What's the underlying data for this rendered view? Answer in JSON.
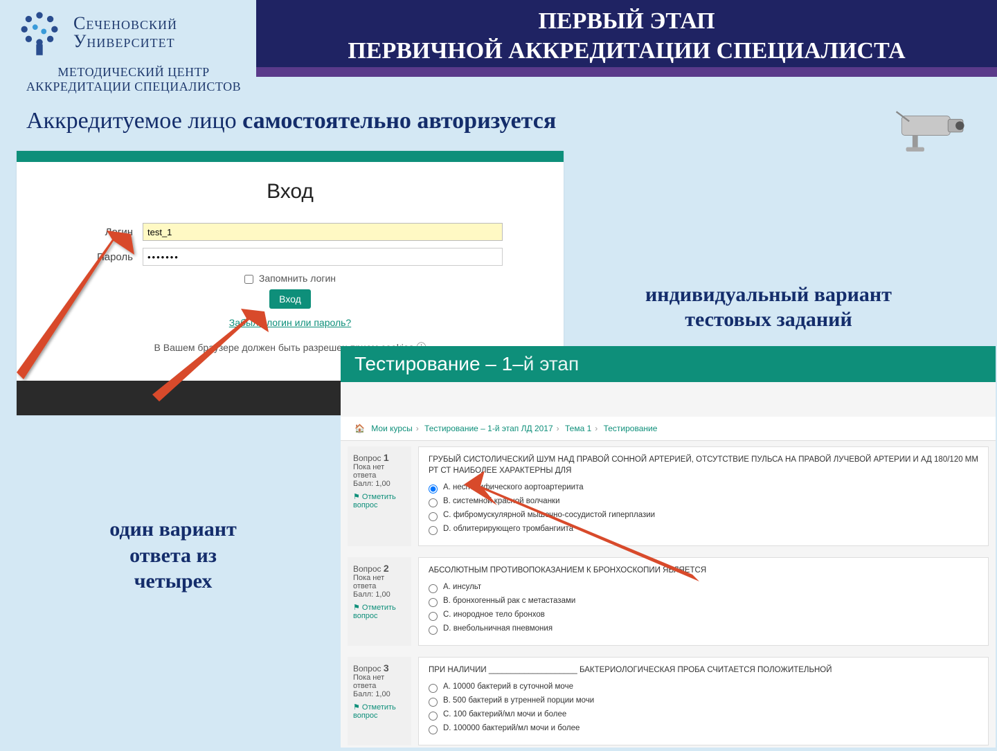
{
  "header": {
    "title_l1": "ПЕРВЫЙ ЭТАП",
    "title_l2": "ПЕРВИЧНОЙ АККРЕДИТАЦИИ СПЕЦИАЛИСТА"
  },
  "logo": {
    "line1": "Сеченовский",
    "line2": "Университет",
    "sub_l1": "МЕТОДИЧЕСКИЙ ЦЕНТР",
    "sub_l2": "АККРЕДИТАЦИИ СПЕЦИАЛИСТОВ"
  },
  "caption_main_plain": "Аккредитуемое лицо ",
  "caption_main_bold": "самостоятельно авторизуется",
  "caption2_l1": "индивидуальный вариант",
  "caption2_l2": "тестовых заданий",
  "caption3_l1": "один вариант",
  "caption3_l2": "ответа из",
  "caption3_l3": "четырех",
  "login": {
    "heading": "Вход",
    "label_login": "Логин",
    "label_pass": "Пароль",
    "value_login": "test_1",
    "value_pass": "•••••••",
    "remember": "Запомнить логин",
    "submit": "Вход",
    "forgot": "Забыли логин или пароль?",
    "cookie": "В Вашем браузере должен быть разрешен прием cookies ⓘ"
  },
  "test": {
    "header_strong": "Тестирование – 1–",
    "header_light": "й этап",
    "crumb": {
      "c1": "Мои курсы",
      "c2": "Тестирование – 1-й этап ЛД 2017",
      "c3": "Тема 1",
      "c4": "Тестирование"
    },
    "questions": [
      {
        "num": "1",
        "side_status": "Пока нет ответа",
        "side_score": "Балл: 1,00",
        "side_flag": "Отметить вопрос",
        "text": "ГРУБЫЙ СИСТОЛИЧЕСКИЙ ШУМ НАД ПРАВОЙ СОННОЙ АРТЕРИЕЙ, ОТСУТСТВИЕ ПУЛЬСА НА ПРАВОЙ ЛУЧЕВОЙ АРТЕРИИ И АД 180/120 ММ РТ СТ НАИБОЛЕЕ ХАРАКТЕРНЫ ДЛЯ",
        "opts": [
          "A. неспецифического аортоартериита",
          "B. системной красной волчанки",
          "C. фибромускулярной мышечно-сосудистой гиперплазии",
          "D. облитерирующего тромбангиита"
        ]
      },
      {
        "num": "2",
        "side_status": "Пока нет ответа",
        "side_score": "Балл: 1,00",
        "side_flag": "Отметить вопрос",
        "text": "АБСОЛЮТНЫМ ПРОТИВОПОКАЗАНИЕМ К БРОНХОСКОПИИ ЯВЛЯЕТСЯ",
        "opts": [
          "A. инсульт",
          "B. бронхогенный рак с метастазами",
          "C. инородное тело бронхов",
          "D. внебольничная пневмония"
        ]
      },
      {
        "num": "3",
        "side_status": "Пока нет ответа",
        "side_score": "Балл: 1,00",
        "side_flag": "Отметить вопрос",
        "text": "ПРИ НАЛИЧИИ ____________________ БАКТЕРИОЛОГИЧЕСКАЯ ПРОБА СЧИТАЕТСЯ ПОЛОЖИТЕЛЬНОЙ",
        "opts": [
          "A. 10000 бактерий в суточной моче",
          "B. 500 бактерий в утренней порции мочи",
          "C. 100 бактерий/мл мочи и более",
          "D. 100000 бактерий/мл мочи и более"
        ]
      }
    ]
  }
}
